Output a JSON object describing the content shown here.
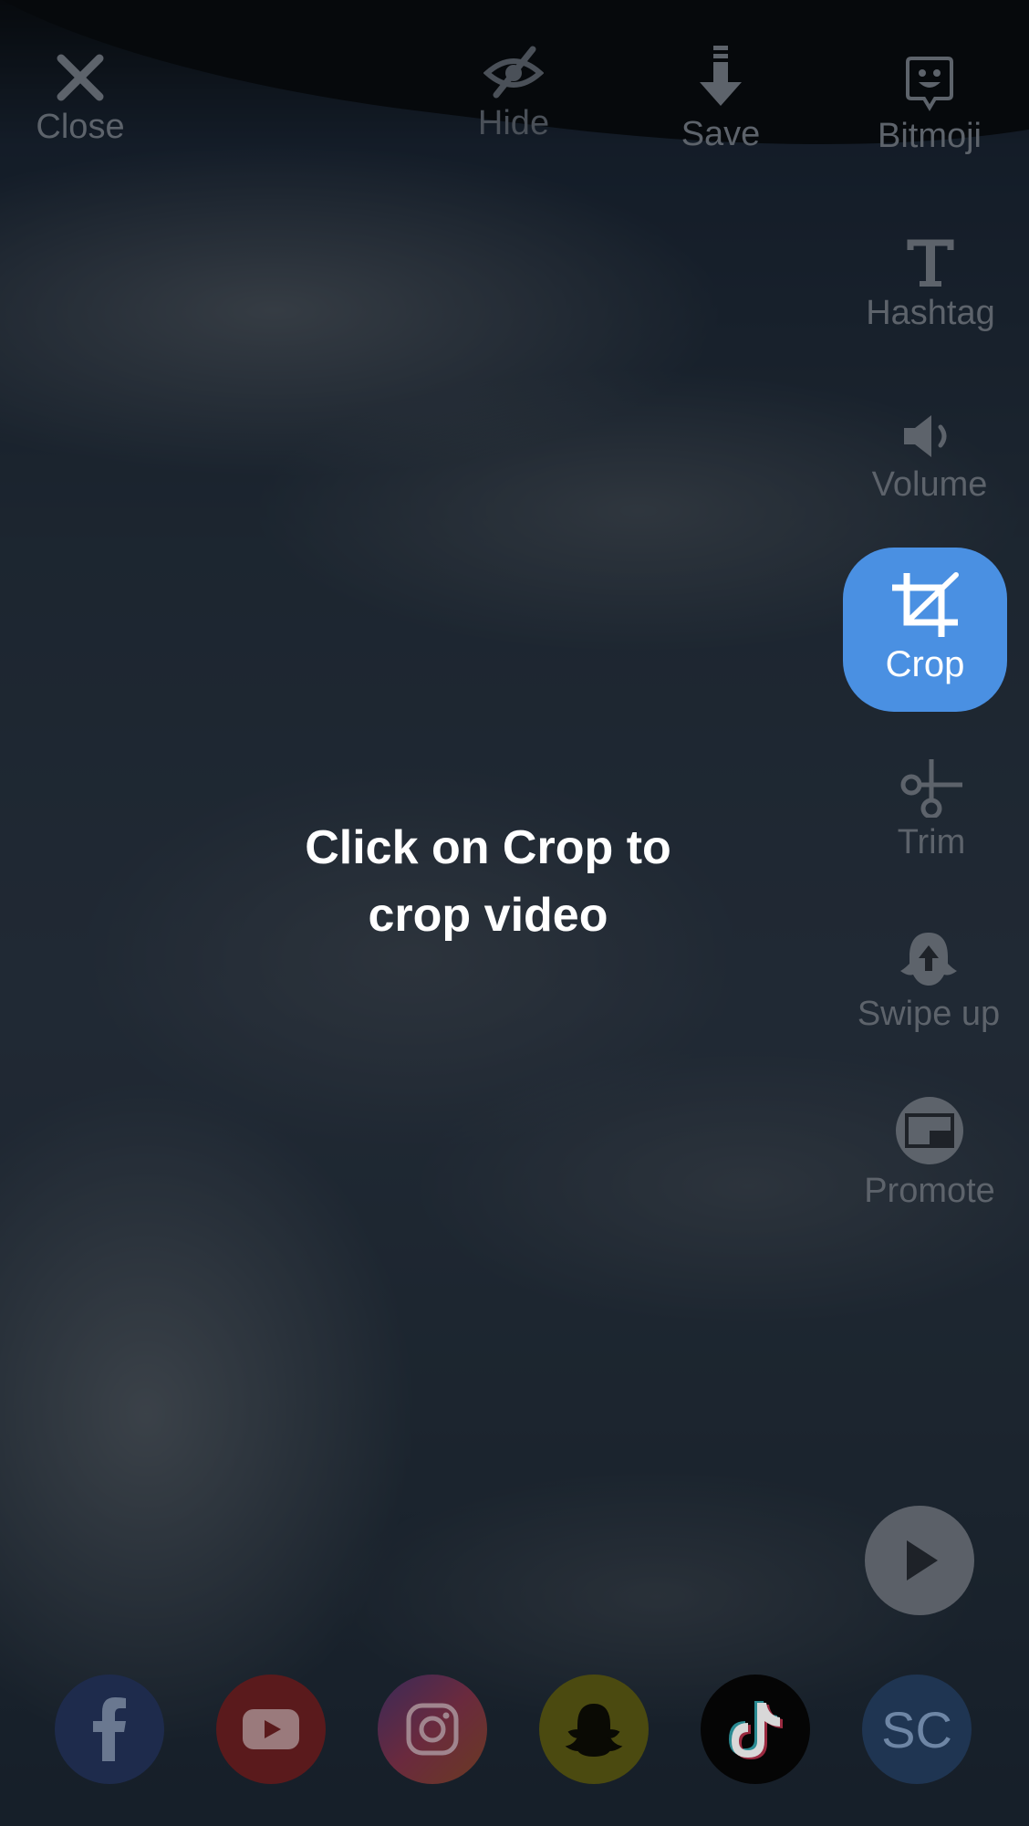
{
  "toolbar": {
    "close_label": "Close",
    "hide_label": "Hide",
    "save_label": "Save",
    "bitmoji_label": "Bitmoji",
    "hashtag_label": "Hashtag",
    "volume_label": "Volume",
    "crop_label": "Crop",
    "trim_label": "Trim",
    "swipe_up_label": "Swipe up",
    "promote_label": "Promote"
  },
  "hint": {
    "line1": "Click on Crop to",
    "line2": "crop video"
  },
  "social": {
    "items": [
      {
        "name": "facebook",
        "icon": "facebook-icon",
        "color": "#1e2b4c"
      },
      {
        "name": "youtube",
        "icon": "youtube-icon",
        "color": "#5a1a1c"
      },
      {
        "name": "instagram",
        "icon": "instagram-icon",
        "color": "#5a2a3e"
      },
      {
        "name": "snapchat",
        "icon": "snapchat-icon",
        "color": "#4b4a10"
      },
      {
        "name": "tiktok",
        "icon": "tiktok-icon",
        "color": "#050505"
      },
      {
        "name": "soundcloud",
        "icon": "sc-icon",
        "color": "#1f3552",
        "text": "SC"
      }
    ]
  },
  "colors": {
    "accent": "#4a90e2",
    "icon_dim": "#5d636b"
  }
}
